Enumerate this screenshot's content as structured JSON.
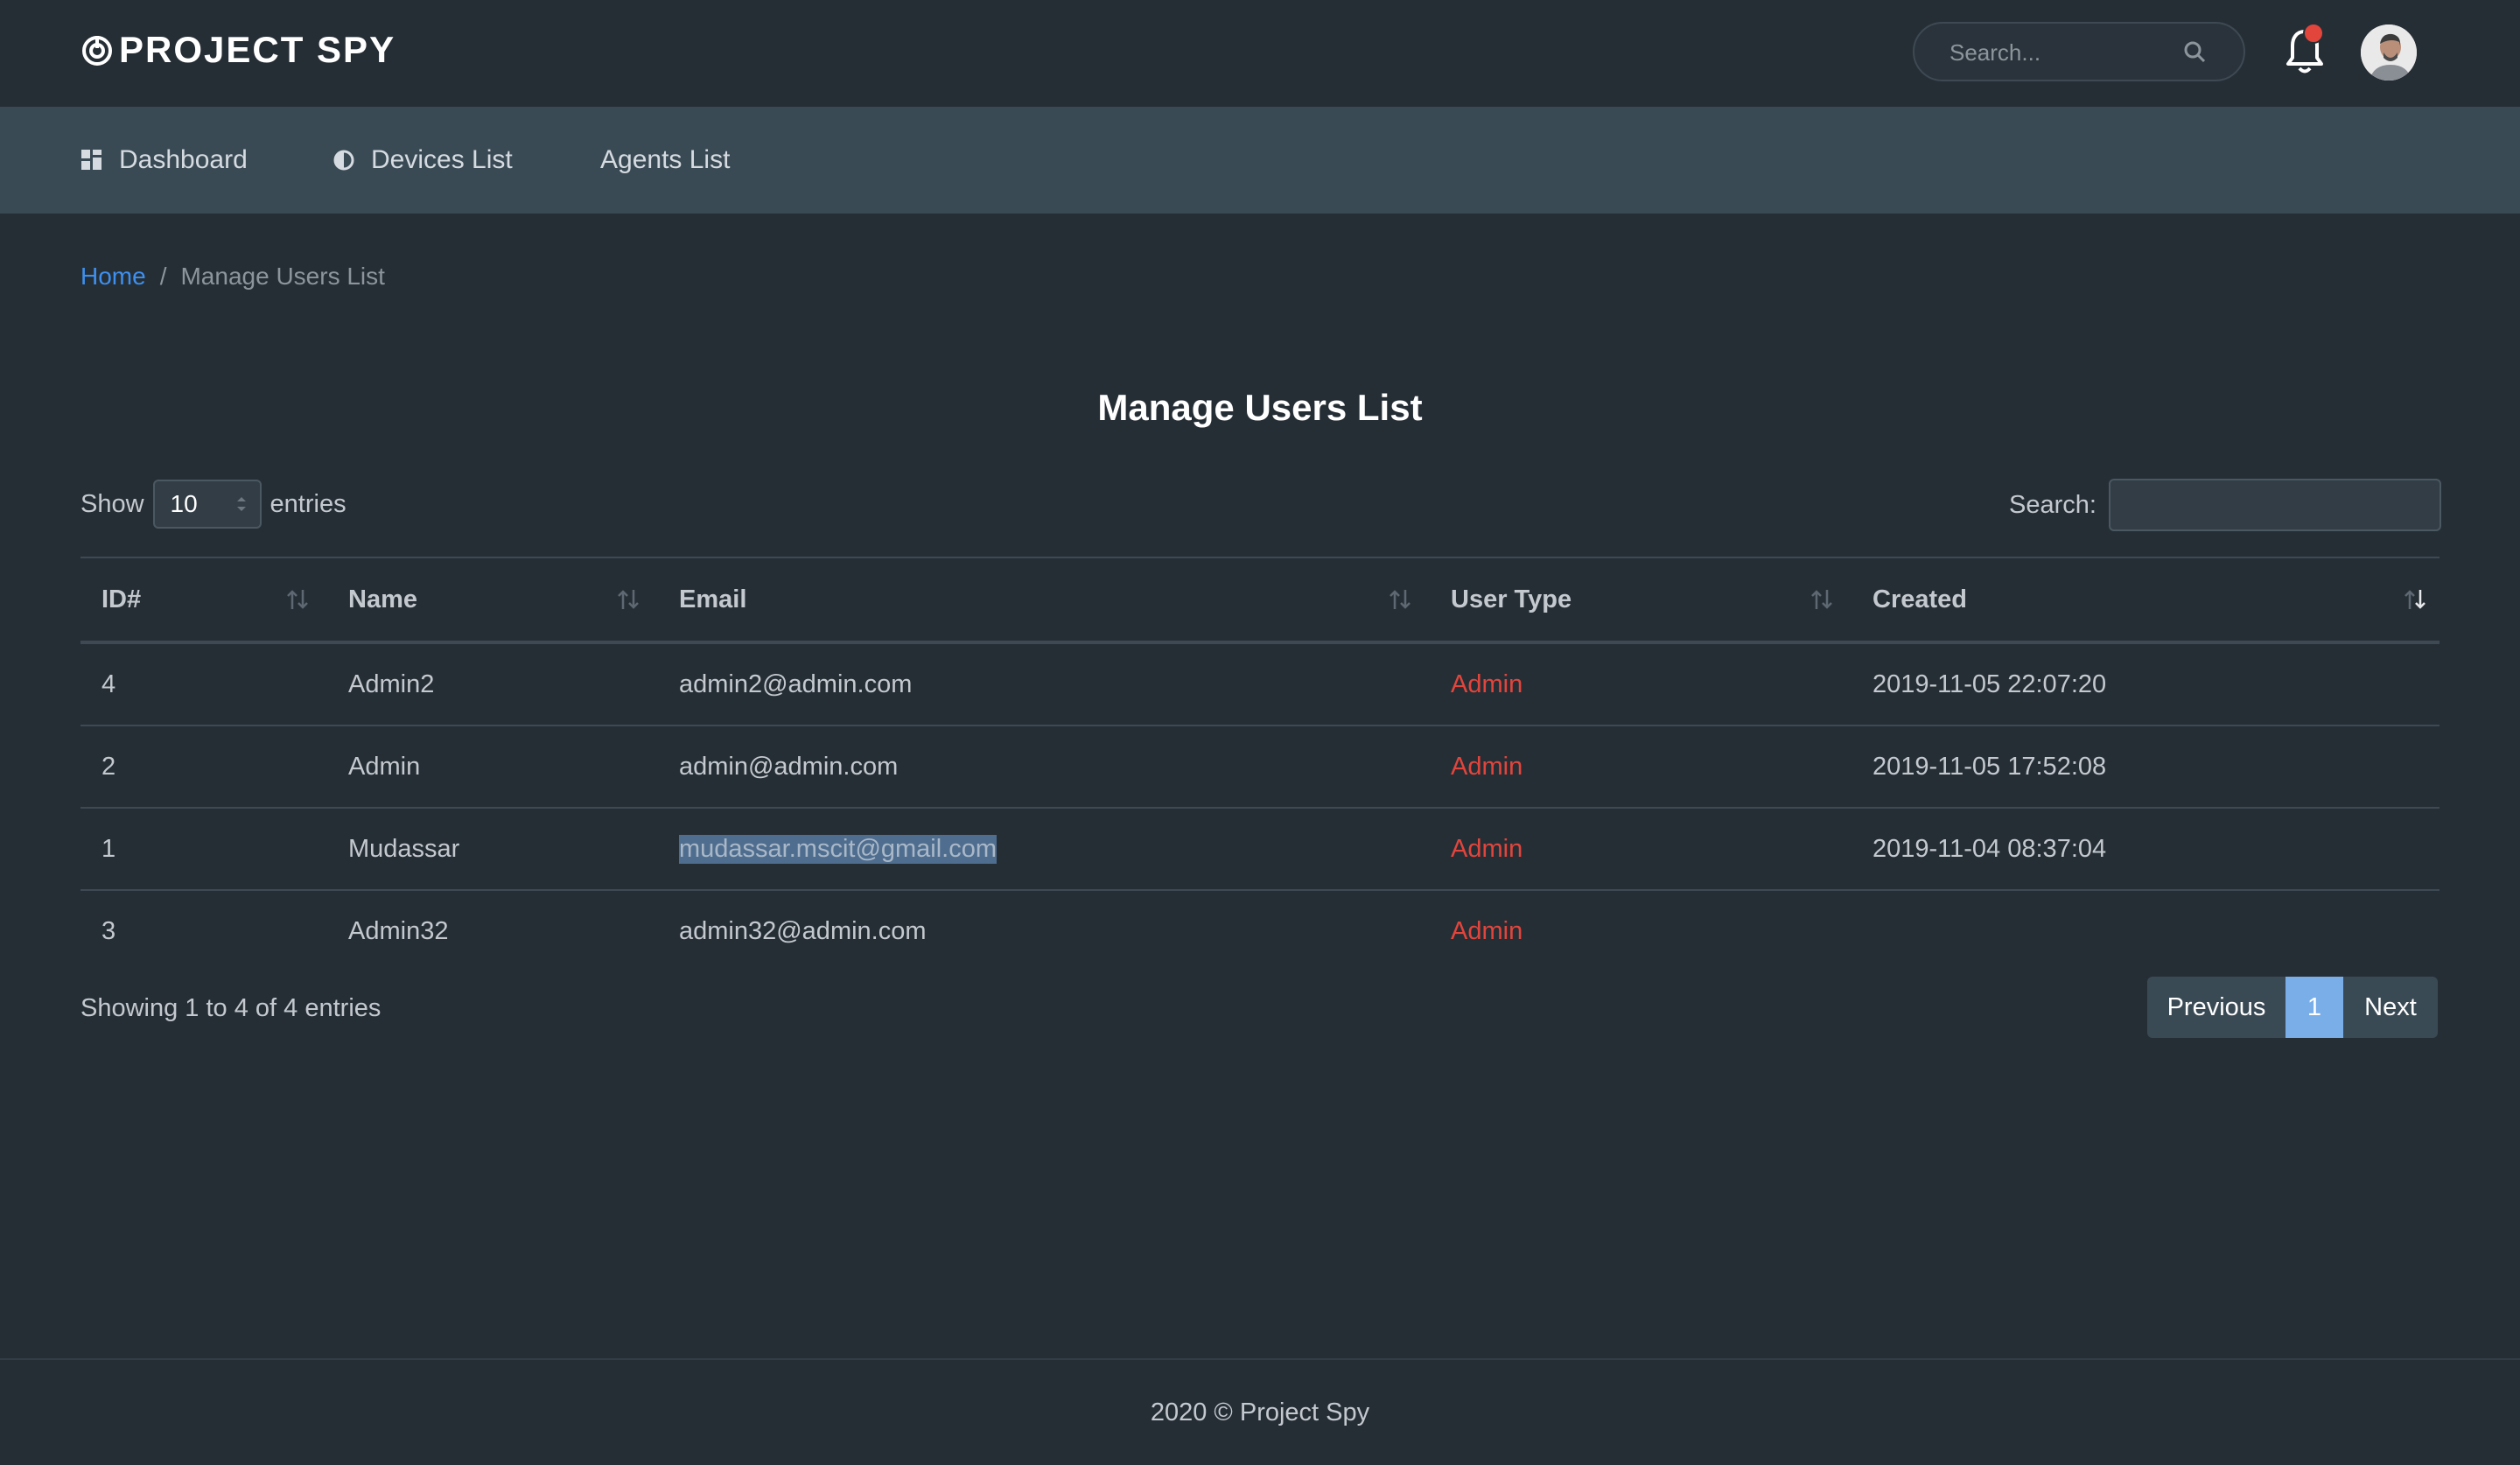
{
  "app": {
    "logo_text": "PROJECT SPY",
    "search_placeholder": "Search..."
  },
  "nav": {
    "items": [
      {
        "label": "Dashboard",
        "icon": "dashboard-grid-icon"
      },
      {
        "label": "Devices List",
        "icon": "half-circle-icon"
      },
      {
        "label": "Agents List",
        "icon": ""
      }
    ]
  },
  "breadcrumb": {
    "home": "Home",
    "separator": "/",
    "current": "Manage Users List"
  },
  "page": {
    "title": "Manage Users List"
  },
  "table_controls": {
    "show_label": "Show",
    "entries_label": "entries",
    "page_length": "10",
    "search_label": "Search:",
    "search_value": ""
  },
  "table": {
    "columns": [
      "ID#",
      "Name",
      "Email",
      "User Type",
      "Created"
    ],
    "rows": [
      {
        "id": "4",
        "name": "Admin2",
        "email": "admin2@admin.com",
        "type": "Admin",
        "created": "2019-11-05 22:07:20"
      },
      {
        "id": "2",
        "name": "Admin",
        "email": "admin@admin.com",
        "type": "Admin",
        "created": "2019-11-05 17:52:08"
      },
      {
        "id": "1",
        "name": "Mudassar",
        "email": "mudassar.mscit@gmail.com",
        "type": "Admin",
        "created": "2019-11-04 08:37:04"
      },
      {
        "id": "3",
        "name": "Admin32",
        "email": "admin32@admin.com",
        "type": "Admin",
        "created": ""
      }
    ],
    "sorted_column": "Created",
    "selected_text_row": 2
  },
  "pagination": {
    "info": "Showing 1 to 4 of 4 entries",
    "previous": "Previous",
    "current_page": "1",
    "next": "Next"
  },
  "footer": {
    "text": "2020 © Project Spy"
  },
  "colors": {
    "background": "#262e35",
    "navbar": "#3a4a55",
    "link": "#3d8ff0",
    "user_type": "#e2453c",
    "active_page": "#7aaee8"
  }
}
